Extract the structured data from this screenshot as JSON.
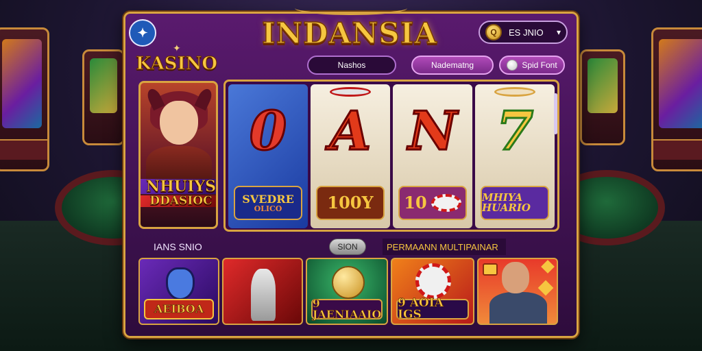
{
  "header": {
    "logo_icon": "wand-icon",
    "title": "INDANSIA",
    "search_label": "ES JNIO",
    "coin_glyph": "Q"
  },
  "brand": "KASINO",
  "nav": {
    "pill_1": "Nashos",
    "pill_2": "Nadematng",
    "pill_3": "Spid Font"
  },
  "hero": {
    "line1": "NHUIYS",
    "line2": "DDASIOC"
  },
  "reels": [
    {
      "symbol": "0",
      "label": "SVEDRE",
      "sublabel": "OLICO"
    },
    {
      "symbol": "A",
      "label": "100Y"
    },
    {
      "symbol": "N",
      "label": "10"
    },
    {
      "symbol": "7",
      "label": "MHIYA HUARIO"
    }
  ],
  "sections": {
    "left": "IANS SNIO",
    "slot_button": "SION",
    "right": "PERMAANN MULTIPAINAR"
  },
  "thumbs": [
    {
      "label": "AEIBOA"
    },
    {
      "label": ""
    },
    {
      "label": "9 JAENIAAIO"
    },
    {
      "label": "9 AOIA IGS"
    },
    {
      "label": ""
    }
  ],
  "colors": {
    "gold": "#d9a441",
    "frame_purple": "#5a1a6e",
    "title_gold": "#f6c640"
  }
}
